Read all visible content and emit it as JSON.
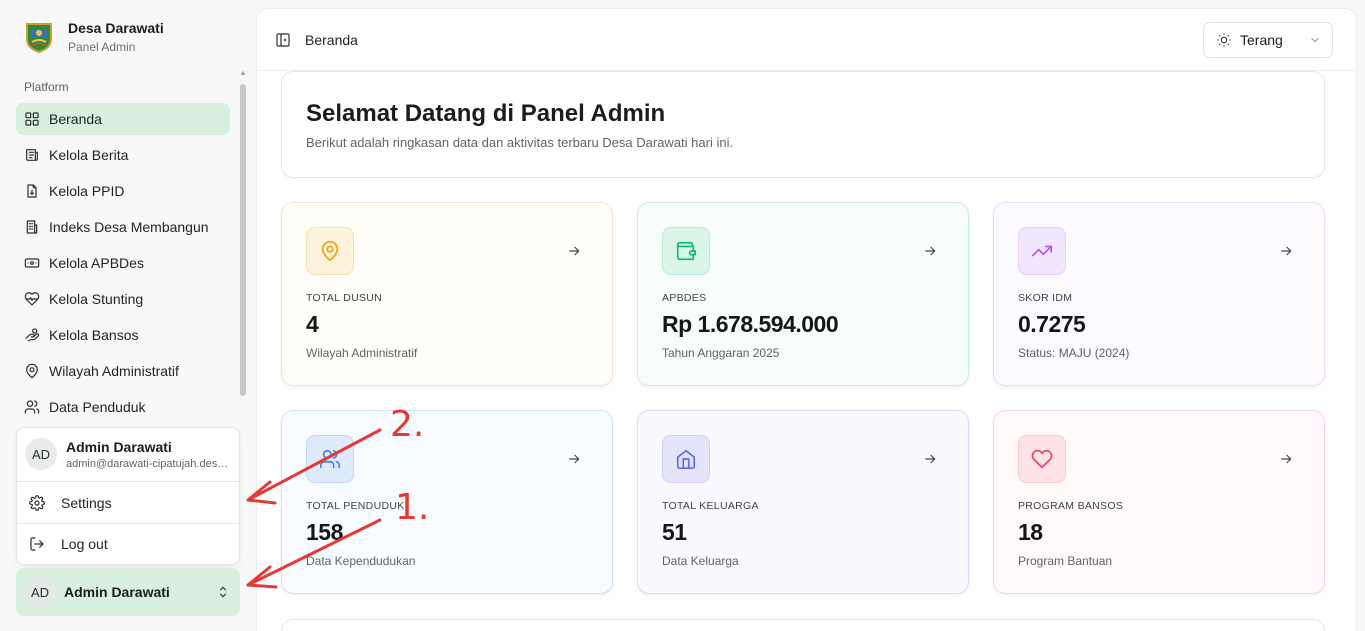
{
  "sidebar": {
    "brand_title": "Desa Darawati",
    "brand_sub": "Panel Admin",
    "section": "Platform",
    "items": [
      {
        "label": "Beranda",
        "icon": "grid-icon"
      },
      {
        "label": "Kelola Berita",
        "icon": "newspaper-icon"
      },
      {
        "label": "Kelola PPID",
        "icon": "file-icon"
      },
      {
        "label": "Indeks Desa Membangun",
        "icon": "building-icon"
      },
      {
        "label": "Kelola APBDes",
        "icon": "banknote-icon"
      },
      {
        "label": "Kelola Stunting",
        "icon": "heart-pulse-icon"
      },
      {
        "label": "Kelola Bansos",
        "icon": "hand-coins-icon"
      },
      {
        "label": "Wilayah Administratif",
        "icon": "map-pin-icon"
      },
      {
        "label": "Data Penduduk",
        "icon": "users-icon"
      }
    ]
  },
  "popover": {
    "initials": "AD",
    "name": "Admin Darawati",
    "email": "admin@darawati-cipatujah.desa.id",
    "settings": "Settings",
    "logout": "Log out"
  },
  "user_button": {
    "initials": "AD",
    "name": "Admin Darawati"
  },
  "header": {
    "breadcrumb": "Beranda",
    "theme": "Terang"
  },
  "welcome": {
    "title": "Selamat Datang di Panel Admin",
    "desc": "Berikut adalah ringkasan data dan aktivitas terbaru Desa Darawati hari ini."
  },
  "cards": [
    {
      "label": "TOTAL DUSUN",
      "value": "4",
      "sub": "Wilayah Administratif",
      "icon": "map-pin-icon",
      "color": "#f59e0b"
    },
    {
      "label": "APBDES",
      "value": "Rp 1.678.594.000",
      "sub": "Tahun Anggaran 2025",
      "icon": "wallet-icon",
      "color": "#10b981"
    },
    {
      "label": "SKOR IDM",
      "value": "0.7275",
      "sub": "Status: MAJU (2024)",
      "icon": "trending-up-icon",
      "color": "#a855f7"
    },
    {
      "label": "TOTAL PENDUDUK",
      "value": "158",
      "sub": "Data Kependudukan",
      "icon": "users-icon",
      "color": "#3b82f6"
    },
    {
      "label": "TOTAL KELUARGA",
      "value": "51",
      "sub": "Data Keluarga",
      "icon": "home-icon",
      "color": "#6366f1"
    },
    {
      "label": "PROGRAM BANSOS",
      "value": "18",
      "sub": "Program Bantuan",
      "icon": "heart-icon",
      "color": "#f43f5e"
    }
  ],
  "annotations": [
    "2.",
    "1."
  ]
}
